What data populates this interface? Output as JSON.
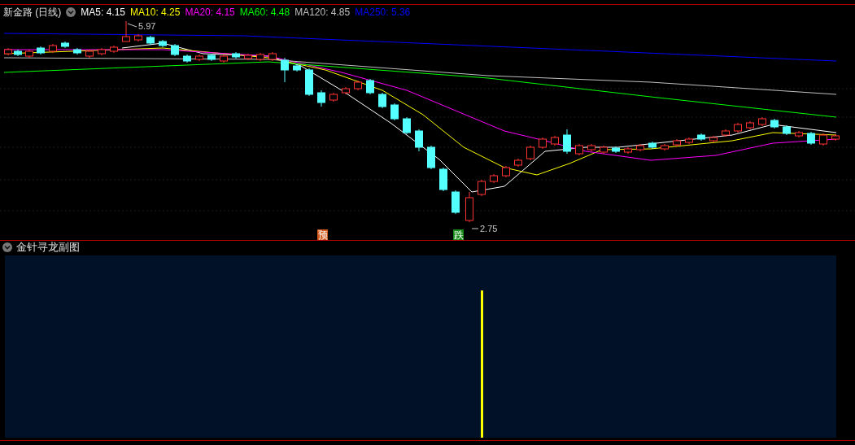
{
  "main_chart": {
    "title": "新金路 (日线)",
    "moving_averages": [
      {
        "label": "MA5: 4.15",
        "color": "#ffffff"
      },
      {
        "label": "MA10: 4.25",
        "color": "#ffff00"
      },
      {
        "label": "MA20: 4.15",
        "color": "#ff00ff"
      },
      {
        "label": "MA60: 4.48",
        "color": "#00ff00"
      },
      {
        "label": "MA120: 4.85",
        "color": "#c0c0c0"
      },
      {
        "label": "MA250: 5.36",
        "color": "#0000ff"
      }
    ],
    "high_label": "5.97",
    "low_label": "2.75",
    "signals": [
      {
        "text": "预",
        "color": "#d2581a"
      },
      {
        "text": "跌",
        "color": "#168a16"
      }
    ]
  },
  "sub_chart": {
    "title": "金针寻龙副图"
  }
}
